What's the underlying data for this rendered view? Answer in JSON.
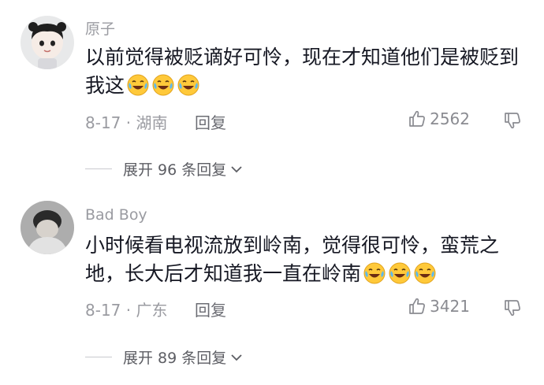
{
  "comments": [
    {
      "username": "原子",
      "text": "以前觉得被贬谪好可怜，现在才知道他们是被贬到我这",
      "emoji_count": 3,
      "date_location": "8-17 · 湖南",
      "reply_label": "回复",
      "likes": "2562",
      "expand_label": "展开 96 条回复"
    },
    {
      "username": "Bad Boy",
      "text": "小时候看电视流放到岭南，觉得很可怜，蛮荒之地，长大后才知道我一直在岭南",
      "emoji_count": 3,
      "date_location": "8-17 · 广东",
      "reply_label": "回复",
      "likes": "3421",
      "expand_label": "展开 89 条回复"
    }
  ],
  "icons": {
    "emoji": "laugh-cry-emoji-icon",
    "like": "thumb-up-icon",
    "dislike": "thumb-down-icon",
    "expand": "chevron-down-icon"
  },
  "colors": {
    "text_primary": "#161823",
    "text_secondary": "#9a9ba1",
    "emoji_yellow": "#ffc93a"
  }
}
